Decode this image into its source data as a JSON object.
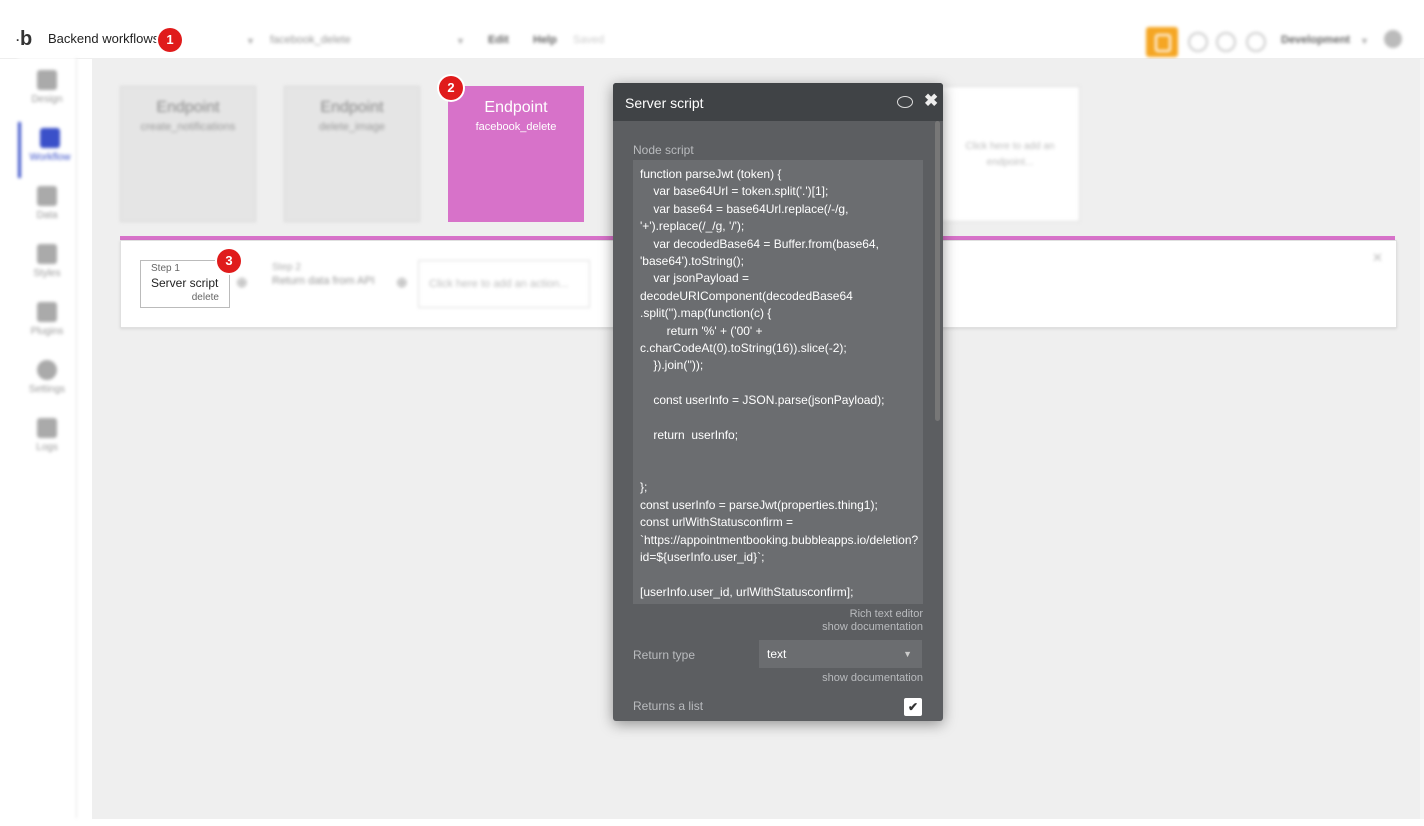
{
  "topbar": {
    "logo": "b",
    "page_name": "Backend workflows",
    "workflow_select": "facebook_delete",
    "menu_edit": "Edit",
    "menu_help": "Help",
    "save_status": "Saved",
    "version": "Development"
  },
  "badges": [
    "1",
    "2",
    "3"
  ],
  "sidebar": {
    "items": [
      {
        "label": "Design",
        "icon": "design-icon"
      },
      {
        "label": "Workflow",
        "icon": "workflow-icon"
      },
      {
        "label": "Data",
        "icon": "data-icon"
      },
      {
        "label": "Styles",
        "icon": "styles-icon"
      },
      {
        "label": "Plugins",
        "icon": "plugins-icon"
      },
      {
        "label": "Settings",
        "icon": "gear-icon"
      },
      {
        "label": "Logs",
        "icon": "logs-icon"
      }
    ]
  },
  "endpoints": [
    {
      "title": "Endpoint",
      "name": "create_notifications"
    },
    {
      "title": "Endpoint",
      "name": "delete_image"
    },
    {
      "title": "Endpoint",
      "name": "facebook_delete"
    }
  ],
  "add_endpoint": "Click here to add an endpoint...",
  "steps": [
    {
      "num": "Step 1",
      "name": "Server script",
      "sub": "delete"
    },
    {
      "num": "Step 2",
      "name": "Return data from API"
    }
  ],
  "add_action": "Click here to add an action...",
  "modal": {
    "title": "Server script",
    "node_script_label": "Node script",
    "code": "function parseJwt (token) {\n    var base64Url = token.split('.')[1];\n    var base64 = base64Url.replace(/-/g,\n'+').replace(/_/g, '/');\n    var decodedBase64 = Buffer.from(base64,\n'base64').toString();\n    var jsonPayload =\ndecodeURIComponent(decodedBase64\n.split('').map(function(c) {\n        return '%' + ('00' +\nc.charCodeAt(0).toString(16)).slice(-2);\n    }).join(''));\n\n    const userInfo = JSON.parse(jsonPayload);\n\n    return  userInfo;\n\n\n};\nconst userInfo = parseJwt(properties.thing1);\nconst urlWithStatusconfirm =\n`https://appointmentbooking.bubbleapps.io/deletion?\nid=${userInfo.user_id}`;\n\n[userInfo.user_id, urlWithStatusconfirm];",
    "rich_text_editor": "Rich text editor",
    "show_documentation": "show documentation",
    "return_type_label": "Return type",
    "return_type_value": "text",
    "returns_list_label": "Returns a list",
    "returns_list_checked": true
  }
}
